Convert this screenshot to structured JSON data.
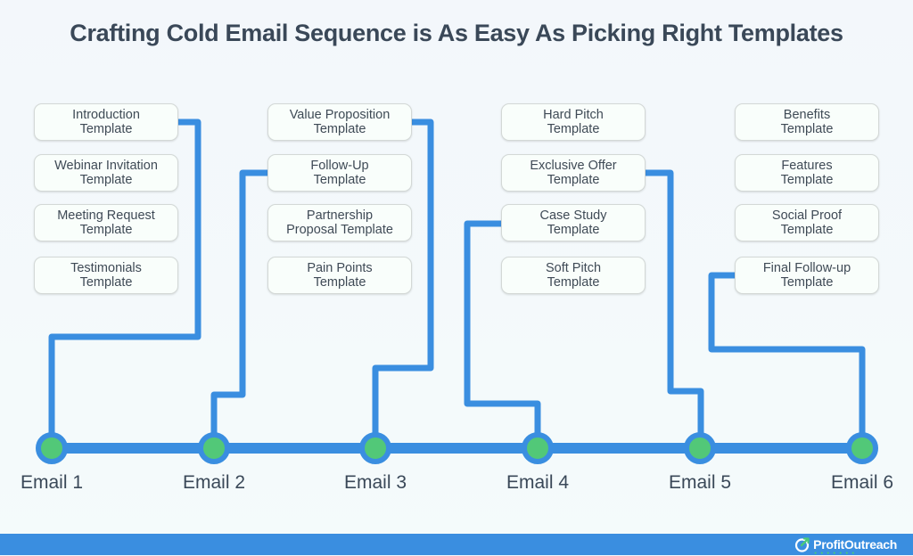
{
  "title": "Crafting Cold Email Sequence is As Easy As Picking Right Templates",
  "colors": {
    "line": "#3a8ee0",
    "node_fill": "#52c878",
    "text": "#3a4858",
    "footer": "#3a8ee0"
  },
  "columns": [
    {
      "email": "Email 1",
      "templates": [
        "Introduction\nTemplate",
        "Webinar Invitation\nTemplate",
        "Meeting Request\nTemplate",
        "Testimonials\nTemplate"
      ],
      "selected": "Introduction Template"
    },
    {
      "email": "Email 2",
      "templates": [
        "Value Proposition\nTemplate",
        "Follow-Up\nTemplate",
        "Partnership\nProposal Template",
        "Pain Points\nTemplate"
      ],
      "selected": "Follow-Up Template"
    },
    {
      "email": "Email 3",
      "templates": [],
      "selected": "Value Proposition Template"
    },
    {
      "email": "Email 4",
      "templates": [
        "Hard Pitch\nTemplate",
        "Exclusive Offer\nTemplate",
        "Case Study\nTemplate",
        "Soft Pitch\nTemplate"
      ],
      "selected": "Case Study Template"
    },
    {
      "email": "Email 5",
      "templates": [],
      "selected": "Exclusive Offer Template"
    },
    {
      "email": "Email 6",
      "templates": [
        "Benefits\nTemplate",
        "Features\nTemplate",
        "Social Proof\nTemplate",
        "Final Follow-up\nTemplate"
      ],
      "selected": "Final Follow-up Template"
    }
  ],
  "template_groups": [
    [
      "Introduction\nTemplate",
      "Webinar Invitation\nTemplate",
      "Meeting Request\nTemplate",
      "Testimonials\nTemplate"
    ],
    [
      "Value Proposition\nTemplate",
      "Follow-Up\nTemplate",
      "Partnership\nProposal Template",
      "Pain Points\nTemplate"
    ],
    [
      "Hard Pitch\nTemplate",
      "Exclusive Offer\nTemplate",
      "Case Study\nTemplate",
      "Soft Pitch\nTemplate"
    ],
    [
      "Benefits\nTemplate",
      "Features\nTemplate",
      "Social Proof\nTemplate",
      "Final Follow-up\nTemplate"
    ]
  ],
  "emails": [
    "Email 1",
    "Email 2",
    "Email 3",
    "Email 4",
    "Email 5",
    "Email 6"
  ],
  "connections": [
    {
      "email": "Email 1",
      "template": "Introduction Template"
    },
    {
      "email": "Email 2",
      "template": "Follow-Up Template"
    },
    {
      "email": "Email 3",
      "template": "Value Proposition Template"
    },
    {
      "email": "Email 4",
      "template": "Case Study Template"
    },
    {
      "email": "Email 5",
      "template": "Exclusive Offer Template"
    },
    {
      "email": "Email 6",
      "template": "Final Follow-up Template"
    }
  ],
  "footer": {
    "brand": "ProfitOutreach",
    "brand_icon": "circle-arrow-logo-icon"
  }
}
